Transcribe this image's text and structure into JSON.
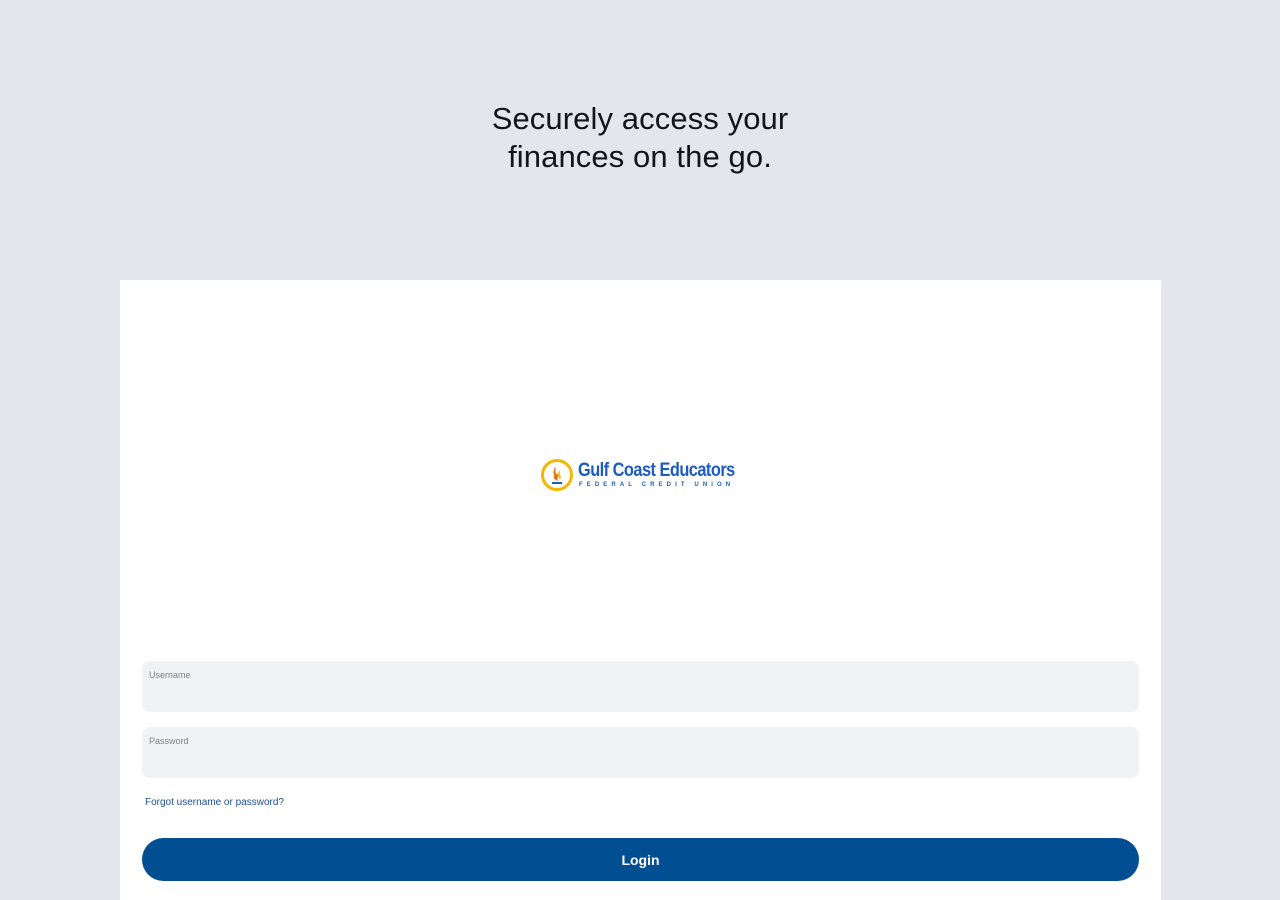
{
  "headline": {
    "line1": "Securely access your",
    "line2": "finances on the go."
  },
  "logo": {
    "name": "Gulf Coast Educators",
    "subtitle": "FEDERAL CREDIT UNION",
    "icon": "flame-circle-icon",
    "colors": {
      "text": "#1c5cc0",
      "ring": "#f5b800",
      "flame": "#e8701a"
    }
  },
  "form": {
    "username_label": "Username",
    "username_value": "",
    "password_label": "Password",
    "password_value": "",
    "forgot_link": "Forgot username or password?",
    "login_label": "Login"
  },
  "colors": {
    "background": "#e3e6ea",
    "card": "#ffffff",
    "field": "#f0f2f4",
    "primary": "#024e92",
    "link": "#1d4e96"
  }
}
